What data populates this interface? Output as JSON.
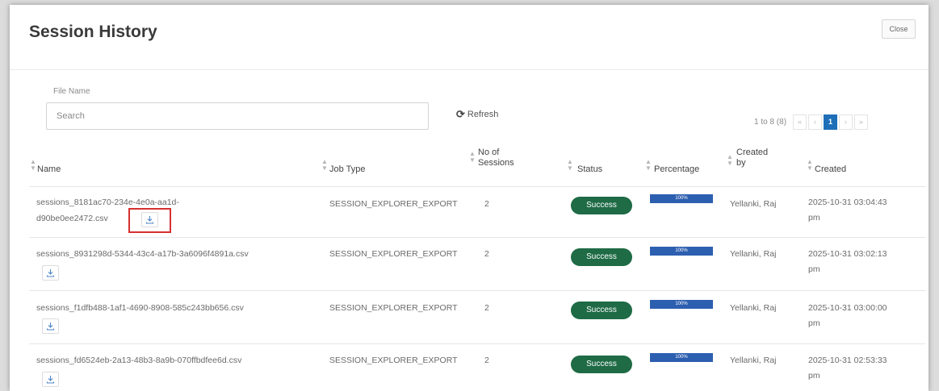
{
  "modal": {
    "title": "Session History",
    "close_label": "Close"
  },
  "filter": {
    "file_label": "File Name",
    "search_placeholder": "Search",
    "refresh_label": "Refresh"
  },
  "pagination": {
    "range_text": "1 to 8 (8)",
    "first": "«",
    "prev": "‹",
    "current": "1",
    "next": "›",
    "last": "»"
  },
  "table": {
    "headers": {
      "name": "Name",
      "job_type": "Job Type",
      "no_of_sessions": [
        "No of",
        "Sessions"
      ],
      "status": "Status",
      "percentage": "Percentage",
      "created_by": [
        "Created",
        "by"
      ],
      "created": "Created"
    },
    "rows": [
      {
        "name_line1": "sessions_8181ac70-234e-4e0a-aa1d-",
        "name_line2": "d90be0ee2472.csv",
        "job_type": "SESSION_EXPLORER_EXPORT",
        "sessions": "2",
        "status": "Success",
        "percentage": 100,
        "percentage_label": "100%",
        "created_by": "Yellanki, Raj",
        "created_line1": "2025-10-31 03:04:43",
        "created_line2": "pm"
      },
      {
        "name_line1": "sessions_8931298d-5344-43c4-a17b-3a6096f4891a.csv",
        "name_line2": "",
        "job_type": "SESSION_EXPLORER_EXPORT",
        "sessions": "2",
        "status": "Success",
        "percentage": 100,
        "percentage_label": "100%",
        "created_by": "Yellanki, Raj",
        "created_line1": "2025-10-31 03:02:13",
        "created_line2": "pm"
      },
      {
        "name_line1": "sessions_f1dfb488-1af1-4690-8908-585c243bb656.csv",
        "name_line2": "",
        "job_type": "SESSION_EXPLORER_EXPORT",
        "sessions": "2",
        "status": "Success",
        "percentage": 100,
        "percentage_label": "100%",
        "created_by": "Yellanki, Raj",
        "created_line1": "2025-10-31 03:00:00",
        "created_line2": "pm"
      },
      {
        "name_line1": "sessions_fd6524eb-2a13-48b3-8a9b-070ffbdfee6d.csv",
        "name_line2": "",
        "job_type": "SESSION_EXPLORER_EXPORT",
        "sessions": "2",
        "status": "Success",
        "percentage": 100,
        "percentage_label": "100%",
        "created_by": "Yellanki, Raj",
        "created_line1": "2025-10-31 02:53:33",
        "created_line2": "pm"
      }
    ]
  },
  "icons": {
    "download": "download-icon",
    "refresh": "refresh-icon",
    "sort": "sort-icon"
  },
  "colors": {
    "status_success": "#1e6b45",
    "progress": "#2d5fb0",
    "pager_active": "#1e6fb8",
    "highlight": "#d63030"
  }
}
